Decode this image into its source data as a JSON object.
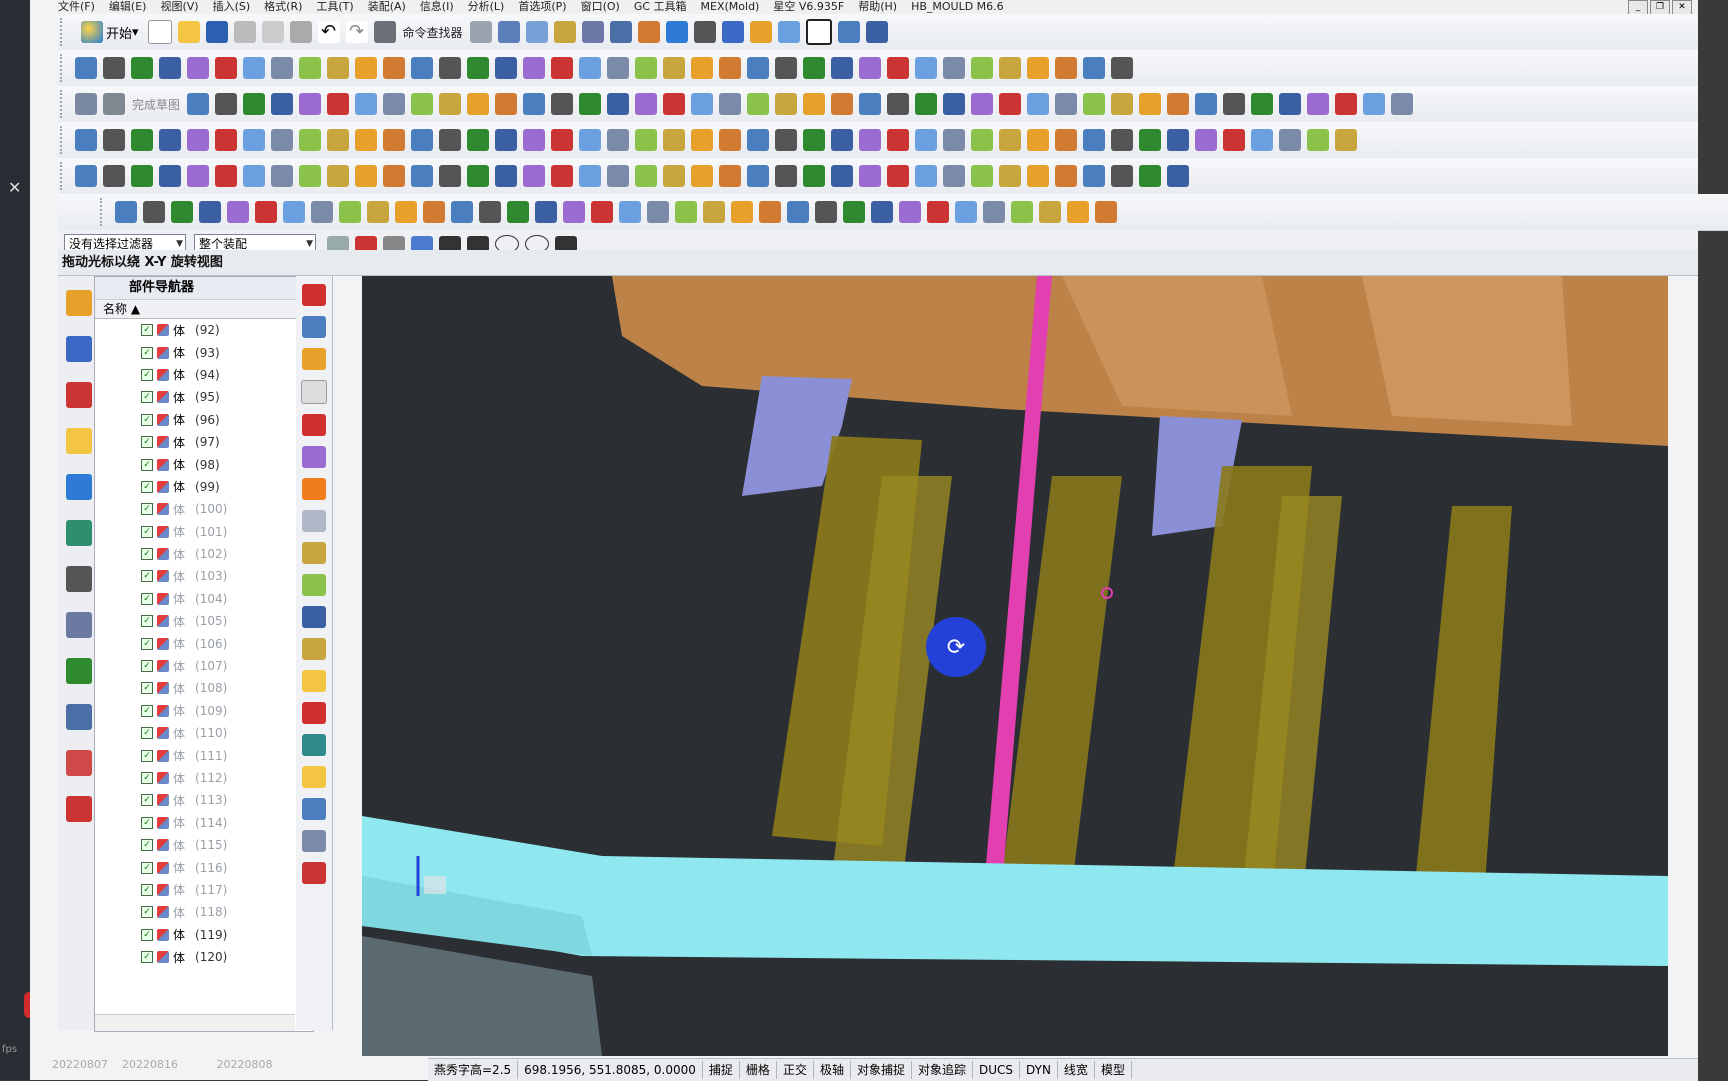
{
  "menu": [
    "文件(F)",
    "编辑(E)",
    "视图(V)",
    "插入(S)",
    "格式(R)",
    "工具(T)",
    "装配(A)",
    "信息(I)",
    "分析(L)",
    "首选项(P)",
    "窗口(O)",
    "GC 工具箱",
    "MEX(Mold)",
    "星空 V6.935F",
    "帮助(H)",
    "HB_MOULD M6.6"
  ],
  "toolbar": {
    "start_label": "开始",
    "cmd_finder_label": "命令查找器",
    "sketch_label": "完成草图"
  },
  "filters": {
    "selection_filter": "没有选择过滤器",
    "assembly_scope": "整个装配"
  },
  "cue_line": "拖动光标以绕 X-Y 旋转视图",
  "navigator": {
    "title": "部件导航器",
    "column_name": "名称",
    "rows": [
      {
        "label": "体",
        "num": "(92)",
        "dim": false
      },
      {
        "label": "体",
        "num": "(93)",
        "dim": false
      },
      {
        "label": "体",
        "num": "(94)",
        "dim": false
      },
      {
        "label": "体",
        "num": "(95)",
        "dim": false
      },
      {
        "label": "体",
        "num": "(96)",
        "dim": false
      },
      {
        "label": "体",
        "num": "(97)",
        "dim": false
      },
      {
        "label": "体",
        "num": "(98)",
        "dim": false
      },
      {
        "label": "体",
        "num": "(99)",
        "dim": false
      },
      {
        "label": "体",
        "num": "(100)",
        "dim": true
      },
      {
        "label": "体",
        "num": "(101)",
        "dim": true
      },
      {
        "label": "体",
        "num": "(102)",
        "dim": true
      },
      {
        "label": "体",
        "num": "(103)",
        "dim": true
      },
      {
        "label": "体",
        "num": "(104)",
        "dim": true
      },
      {
        "label": "体",
        "num": "(105)",
        "dim": true
      },
      {
        "label": "体",
        "num": "(106)",
        "dim": true
      },
      {
        "label": "体",
        "num": "(107)",
        "dim": true
      },
      {
        "label": "体",
        "num": "(108)",
        "dim": true
      },
      {
        "label": "体",
        "num": "(109)",
        "dim": true
      },
      {
        "label": "体",
        "num": "(110)",
        "dim": true
      },
      {
        "label": "体",
        "num": "(111)",
        "dim": true
      },
      {
        "label": "体",
        "num": "(112)",
        "dim": true
      },
      {
        "label": "体",
        "num": "(113)",
        "dim": true
      },
      {
        "label": "体",
        "num": "(114)",
        "dim": true
      },
      {
        "label": "体",
        "num": "(115)",
        "dim": true
      },
      {
        "label": "体",
        "num": "(116)",
        "dim": true
      },
      {
        "label": "体",
        "num": "(117)",
        "dim": true
      },
      {
        "label": "体",
        "num": "(118)",
        "dim": true
      },
      {
        "label": "体",
        "num": "(119)",
        "dim": false
      },
      {
        "label": "体",
        "num": "(120)",
        "dim": false
      }
    ]
  },
  "status": {
    "text_height": "燕秀字高=2.5",
    "coords": "698.1956, 551.8085, 0.0000",
    "snap": "捕捉",
    "grid": "栅格",
    "ortho": "正交",
    "polar": "极轴",
    "obj_snap": "对象捕捉",
    "obj_track": "对象追踪",
    "ducs": "DUCS",
    "dyn": "DYN",
    "lineweight": "线宽",
    "model": "模型"
  },
  "taskbar_dates": [
    "20220807",
    "20220816",
    "20220808"
  ],
  "fps_label": "fps",
  "colors": {
    "plate": "#c98a4a",
    "slider": "#8b8fd6",
    "pin": "#8a7a1a",
    "rod": "#e23fb0",
    "base": "#8fe8f0",
    "rotate_cursor": "#2341d8"
  }
}
